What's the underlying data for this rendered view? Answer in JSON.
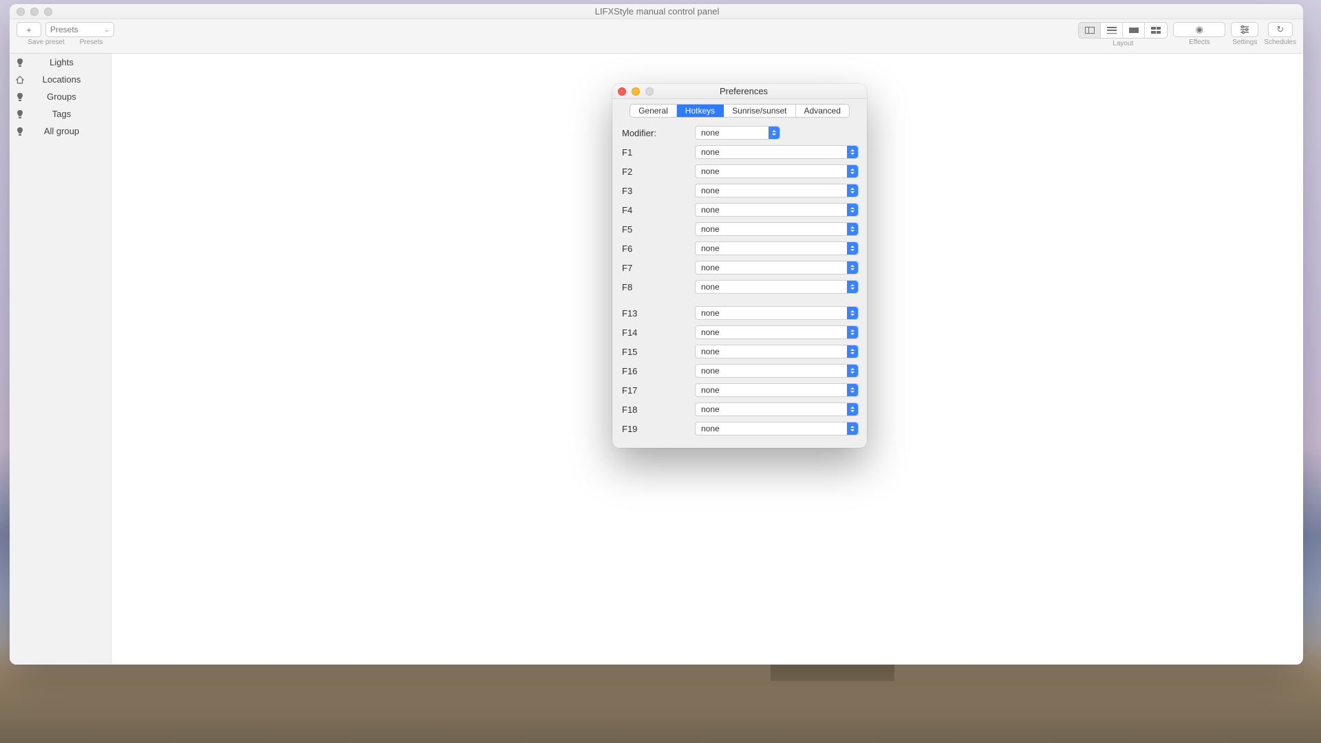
{
  "window": {
    "title": "LIFXStyle manual control panel"
  },
  "toolbar": {
    "add_label": "+",
    "presets_selector": "Presets",
    "save_preset": "Save preset",
    "presets_label": "Presets",
    "layout_label": "Layout",
    "effects_label": "Effects",
    "settings_label": "Settings",
    "schedules_label": "Schedules"
  },
  "sidebar": {
    "items": [
      {
        "label": "Lights"
      },
      {
        "label": "Locations"
      },
      {
        "label": "Groups"
      },
      {
        "label": "Tags"
      },
      {
        "label": "All group"
      }
    ]
  },
  "prefs": {
    "title": "Preferences",
    "tabs": {
      "general": "General",
      "hotkeys": "Hotkeys",
      "sunrise": "Sunrise/sunset",
      "advanced": "Advanced"
    },
    "modifier_label": "Modifier:",
    "modifier_value": "none",
    "rows1": [
      {
        "label": "F1",
        "value": "none"
      },
      {
        "label": "F2",
        "value": "none"
      },
      {
        "label": "F3",
        "value": "none"
      },
      {
        "label": "F4",
        "value": "none"
      },
      {
        "label": "F5",
        "value": "none"
      },
      {
        "label": "F6",
        "value": "none"
      },
      {
        "label": "F7",
        "value": "none"
      },
      {
        "label": "F8",
        "value": "none"
      }
    ],
    "rows2": [
      {
        "label": "F13",
        "value": "none"
      },
      {
        "label": "F14",
        "value": "none"
      },
      {
        "label": "F15",
        "value": "none"
      },
      {
        "label": "F16",
        "value": "none"
      },
      {
        "label": "F17",
        "value": "none"
      },
      {
        "label": "F18",
        "value": "none"
      },
      {
        "label": "F19",
        "value": "none"
      }
    ]
  }
}
